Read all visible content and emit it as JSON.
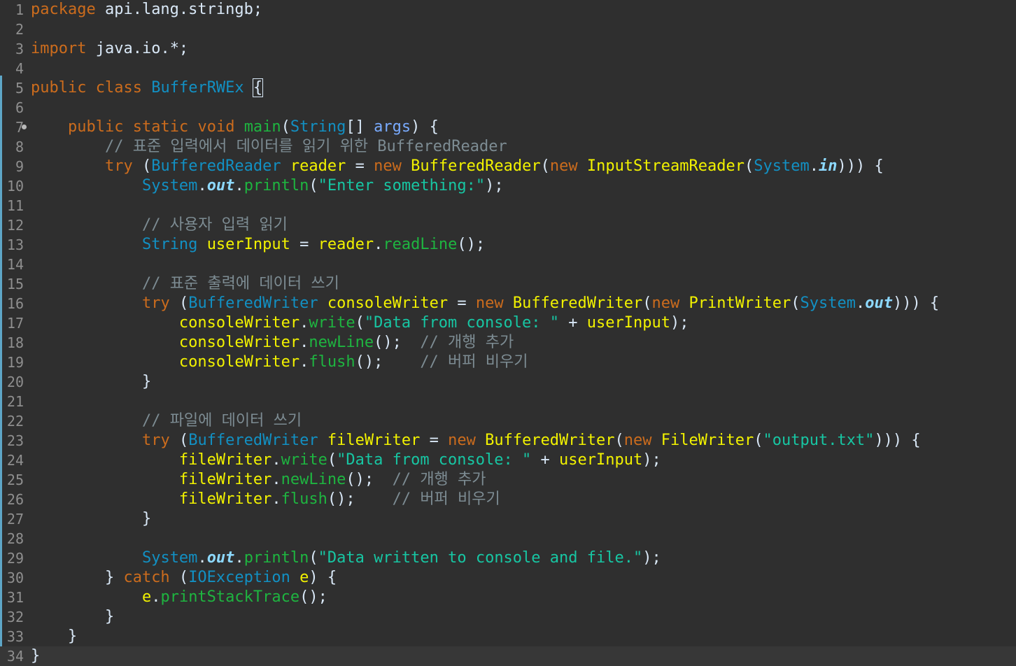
{
  "editor": {
    "lines": [
      {
        "n": "1",
        "tokens": [
          {
            "c": "kw",
            "t": "package"
          },
          {
            "c": "df",
            "t": " api.lang.stringb;"
          }
        ]
      },
      {
        "n": "2",
        "tokens": []
      },
      {
        "n": "3",
        "tokens": [
          {
            "c": "kw",
            "t": "import"
          },
          {
            "c": "df",
            "t": " java.io.*;"
          }
        ]
      },
      {
        "n": "4",
        "tokens": []
      },
      {
        "n": "5",
        "tokens": [
          {
            "c": "kw",
            "t": "public"
          },
          {
            "c": "df",
            "t": " "
          },
          {
            "c": "kw",
            "t": "class"
          },
          {
            "c": "df",
            "t": " "
          },
          {
            "c": "ty",
            "t": "BufferRWEx"
          },
          {
            "c": "df",
            "t": " "
          },
          {
            "c": "bracket-box df",
            "t": "{"
          }
        ]
      },
      {
        "n": "6",
        "tokens": []
      },
      {
        "n": "7",
        "fold": true,
        "tokens": [
          {
            "c": "df",
            "t": "    "
          },
          {
            "c": "kw",
            "t": "public"
          },
          {
            "c": "df",
            "t": " "
          },
          {
            "c": "kw",
            "t": "static"
          },
          {
            "c": "df",
            "t": " "
          },
          {
            "c": "kw",
            "t": "void"
          },
          {
            "c": "df",
            "t": " "
          },
          {
            "c": "fn",
            "t": "main"
          },
          {
            "c": "df",
            "t": "("
          },
          {
            "c": "ty",
            "t": "String"
          },
          {
            "c": "df",
            "t": "[] "
          },
          {
            "c": "pr",
            "t": "args"
          },
          {
            "c": "df",
            "t": ") {"
          }
        ]
      },
      {
        "n": "8",
        "tokens": [
          {
            "c": "df",
            "t": "        "
          },
          {
            "c": "cm",
            "t": "// 표준 입력에서 데이터를 읽기 위한 BufferedReader"
          }
        ]
      },
      {
        "n": "9",
        "tokens": [
          {
            "c": "df",
            "t": "        "
          },
          {
            "c": "kw",
            "t": "try"
          },
          {
            "c": "df",
            "t": " ("
          },
          {
            "c": "ty",
            "t": "BufferedReader"
          },
          {
            "c": "df",
            "t": " "
          },
          {
            "c": "nm",
            "t": "reader"
          },
          {
            "c": "df",
            "t": " = "
          },
          {
            "c": "kw",
            "t": "new"
          },
          {
            "c": "df",
            "t": " "
          },
          {
            "c": "nm",
            "t": "BufferedReader"
          },
          {
            "c": "df",
            "t": "("
          },
          {
            "c": "kw",
            "t": "new"
          },
          {
            "c": "df",
            "t": " "
          },
          {
            "c": "nm",
            "t": "InputStreamReader"
          },
          {
            "c": "df",
            "t": "("
          },
          {
            "c": "ty",
            "t": "System"
          },
          {
            "c": "df",
            "t": "."
          },
          {
            "c": "fld",
            "t": "in"
          },
          {
            "c": "df",
            "t": "))) {"
          }
        ]
      },
      {
        "n": "10",
        "tokens": [
          {
            "c": "df",
            "t": "            "
          },
          {
            "c": "ty",
            "t": "System"
          },
          {
            "c": "df",
            "t": "."
          },
          {
            "c": "fld",
            "t": "out"
          },
          {
            "c": "df",
            "t": "."
          },
          {
            "c": "fn",
            "t": "println"
          },
          {
            "c": "df",
            "t": "("
          },
          {
            "c": "st",
            "t": "\"Enter something:\""
          },
          {
            "c": "df",
            "t": ");"
          }
        ]
      },
      {
        "n": "11",
        "tokens": []
      },
      {
        "n": "12",
        "tokens": [
          {
            "c": "df",
            "t": "            "
          },
          {
            "c": "cm",
            "t": "// 사용자 입력 읽기"
          }
        ]
      },
      {
        "n": "13",
        "tokens": [
          {
            "c": "df",
            "t": "            "
          },
          {
            "c": "ty",
            "t": "String"
          },
          {
            "c": "df",
            "t": " "
          },
          {
            "c": "nm",
            "t": "userInput"
          },
          {
            "c": "df",
            "t": " = "
          },
          {
            "c": "nm",
            "t": "reader"
          },
          {
            "c": "df",
            "t": "."
          },
          {
            "c": "fn",
            "t": "readLine"
          },
          {
            "c": "df",
            "t": "();"
          }
        ]
      },
      {
        "n": "14",
        "tokens": []
      },
      {
        "n": "15",
        "tokens": [
          {
            "c": "df",
            "t": "            "
          },
          {
            "c": "cm",
            "t": "// 표준 출력에 데이터 쓰기"
          }
        ]
      },
      {
        "n": "16",
        "tokens": [
          {
            "c": "df",
            "t": "            "
          },
          {
            "c": "kw",
            "t": "try"
          },
          {
            "c": "df",
            "t": " ("
          },
          {
            "c": "ty",
            "t": "BufferedWriter"
          },
          {
            "c": "df",
            "t": " "
          },
          {
            "c": "nm",
            "t": "consoleWriter"
          },
          {
            "c": "df",
            "t": " = "
          },
          {
            "c": "kw",
            "t": "new"
          },
          {
            "c": "df",
            "t": " "
          },
          {
            "c": "nm",
            "t": "BufferedWriter"
          },
          {
            "c": "df",
            "t": "("
          },
          {
            "c": "kw",
            "t": "new"
          },
          {
            "c": "df",
            "t": " "
          },
          {
            "c": "nm",
            "t": "PrintWriter"
          },
          {
            "c": "df",
            "t": "("
          },
          {
            "c": "ty",
            "t": "System"
          },
          {
            "c": "df",
            "t": "."
          },
          {
            "c": "fld",
            "t": "out"
          },
          {
            "c": "df",
            "t": "))) {"
          }
        ]
      },
      {
        "n": "17",
        "tokens": [
          {
            "c": "df",
            "t": "                "
          },
          {
            "c": "nm",
            "t": "consoleWriter"
          },
          {
            "c": "df",
            "t": "."
          },
          {
            "c": "fn",
            "t": "write"
          },
          {
            "c": "df",
            "t": "("
          },
          {
            "c": "st",
            "t": "\"Data from console: \""
          },
          {
            "c": "df",
            "t": " + "
          },
          {
            "c": "nm",
            "t": "userInput"
          },
          {
            "c": "df",
            "t": ");"
          }
        ]
      },
      {
        "n": "18",
        "tokens": [
          {
            "c": "df",
            "t": "                "
          },
          {
            "c": "nm",
            "t": "consoleWriter"
          },
          {
            "c": "df",
            "t": "."
          },
          {
            "c": "fn",
            "t": "newLine"
          },
          {
            "c": "df",
            "t": "();  "
          },
          {
            "c": "cm",
            "t": "// 개행 추가"
          }
        ]
      },
      {
        "n": "19",
        "tokens": [
          {
            "c": "df",
            "t": "                "
          },
          {
            "c": "nm",
            "t": "consoleWriter"
          },
          {
            "c": "df",
            "t": "."
          },
          {
            "c": "fn",
            "t": "flush"
          },
          {
            "c": "df",
            "t": "();    "
          },
          {
            "c": "cm",
            "t": "// 버퍼 비우기"
          }
        ]
      },
      {
        "n": "20",
        "tokens": [
          {
            "c": "df",
            "t": "            }"
          }
        ]
      },
      {
        "n": "21",
        "tokens": []
      },
      {
        "n": "22",
        "tokens": [
          {
            "c": "df",
            "t": "            "
          },
          {
            "c": "cm",
            "t": "// 파일에 데이터 쓰기"
          }
        ]
      },
      {
        "n": "23",
        "tokens": [
          {
            "c": "df",
            "t": "            "
          },
          {
            "c": "kw",
            "t": "try"
          },
          {
            "c": "df",
            "t": " ("
          },
          {
            "c": "ty",
            "t": "BufferedWriter"
          },
          {
            "c": "df",
            "t": " "
          },
          {
            "c": "nm",
            "t": "fileWriter"
          },
          {
            "c": "df",
            "t": " = "
          },
          {
            "c": "kw",
            "t": "new"
          },
          {
            "c": "df",
            "t": " "
          },
          {
            "c": "nm",
            "t": "BufferedWriter"
          },
          {
            "c": "df",
            "t": "("
          },
          {
            "c": "kw",
            "t": "new"
          },
          {
            "c": "df",
            "t": " "
          },
          {
            "c": "nm",
            "t": "FileWriter"
          },
          {
            "c": "df",
            "t": "("
          },
          {
            "c": "st",
            "t": "\"output.txt\""
          },
          {
            "c": "df",
            "t": "))) {"
          }
        ]
      },
      {
        "n": "24",
        "tokens": [
          {
            "c": "df",
            "t": "                "
          },
          {
            "c": "nm",
            "t": "fileWriter"
          },
          {
            "c": "df",
            "t": "."
          },
          {
            "c": "fn",
            "t": "write"
          },
          {
            "c": "df",
            "t": "("
          },
          {
            "c": "st",
            "t": "\"Data from console: \""
          },
          {
            "c": "df",
            "t": " + "
          },
          {
            "c": "nm",
            "t": "userInput"
          },
          {
            "c": "df",
            "t": ");"
          }
        ]
      },
      {
        "n": "25",
        "tokens": [
          {
            "c": "df",
            "t": "                "
          },
          {
            "c": "nm",
            "t": "fileWriter"
          },
          {
            "c": "df",
            "t": "."
          },
          {
            "c": "fn",
            "t": "newLine"
          },
          {
            "c": "df",
            "t": "();  "
          },
          {
            "c": "cm",
            "t": "// 개행 추가"
          }
        ]
      },
      {
        "n": "26",
        "tokens": [
          {
            "c": "df",
            "t": "                "
          },
          {
            "c": "nm",
            "t": "fileWriter"
          },
          {
            "c": "df",
            "t": "."
          },
          {
            "c": "fn",
            "t": "flush"
          },
          {
            "c": "df",
            "t": "();    "
          },
          {
            "c": "cm",
            "t": "// 버퍼 비우기"
          }
        ]
      },
      {
        "n": "27",
        "tokens": [
          {
            "c": "df",
            "t": "            }"
          }
        ]
      },
      {
        "n": "28",
        "tokens": []
      },
      {
        "n": "29",
        "tokens": [
          {
            "c": "df",
            "t": "            "
          },
          {
            "c": "ty",
            "t": "System"
          },
          {
            "c": "df",
            "t": "."
          },
          {
            "c": "fld",
            "t": "out"
          },
          {
            "c": "df",
            "t": "."
          },
          {
            "c": "fn",
            "t": "println"
          },
          {
            "c": "df",
            "t": "("
          },
          {
            "c": "st",
            "t": "\"Data written to console and file.\""
          },
          {
            "c": "df",
            "t": ");"
          }
        ]
      },
      {
        "n": "30",
        "tokens": [
          {
            "c": "df",
            "t": "        } "
          },
          {
            "c": "kw",
            "t": "catch"
          },
          {
            "c": "df",
            "t": " ("
          },
          {
            "c": "ty",
            "t": "IOException"
          },
          {
            "c": "df",
            "t": " "
          },
          {
            "c": "nm",
            "t": "e"
          },
          {
            "c": "df",
            "t": ") {"
          }
        ]
      },
      {
        "n": "31",
        "tokens": [
          {
            "c": "df",
            "t": "            "
          },
          {
            "c": "nm",
            "t": "e"
          },
          {
            "c": "df",
            "t": "."
          },
          {
            "c": "fn",
            "t": "printStackTrace"
          },
          {
            "c": "df",
            "t": "();"
          }
        ]
      },
      {
        "n": "32",
        "tokens": [
          {
            "c": "df",
            "t": "        }"
          }
        ]
      },
      {
        "n": "33",
        "tokens": [
          {
            "c": "df",
            "t": "    }"
          }
        ]
      },
      {
        "n": "34",
        "current": true,
        "tokens": [
          {
            "c": "df",
            "t": "}"
          }
        ]
      }
    ]
  }
}
